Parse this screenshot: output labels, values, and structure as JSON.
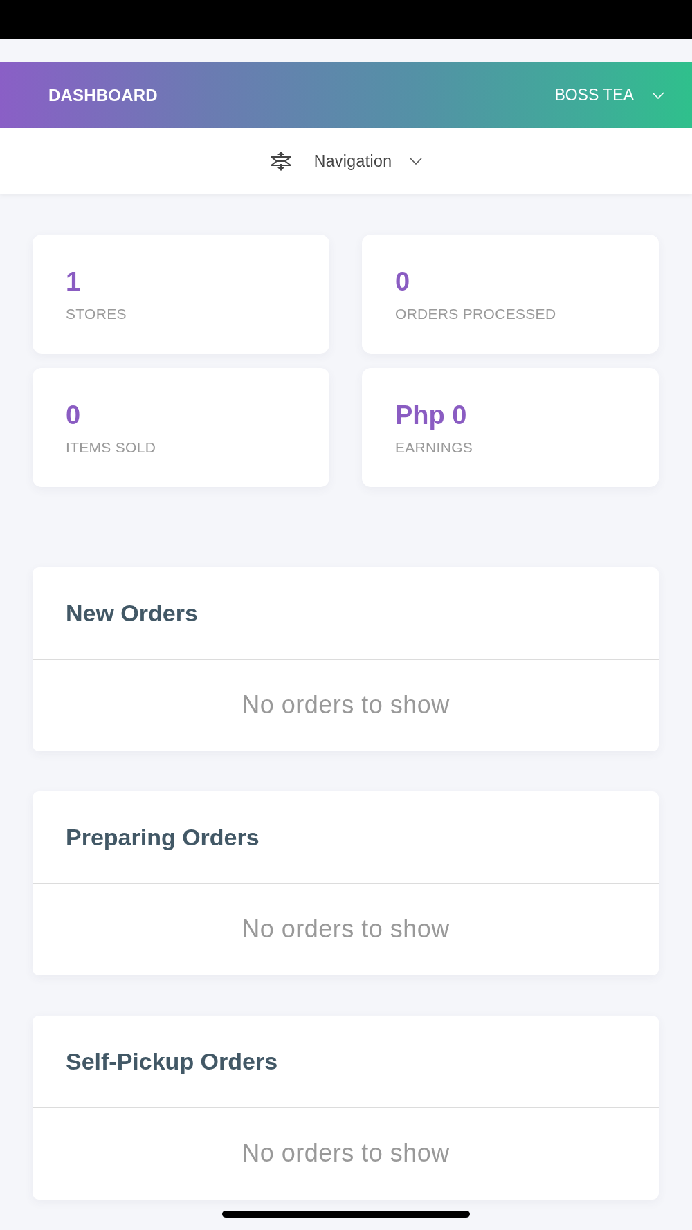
{
  "header": {
    "title": "DASHBOARD",
    "account": "BOSS TEA"
  },
  "navigation": {
    "label": "Navigation"
  },
  "stats": [
    {
      "value": "1",
      "label": "STORES"
    },
    {
      "value": "0",
      "label": "ORDERS PROCESSED"
    },
    {
      "value": "0",
      "label": "ITEMS SOLD"
    },
    {
      "value": "Php 0",
      "label": "EARNINGS"
    }
  ],
  "panels": [
    {
      "title": "New Orders",
      "empty_message": "No orders to show"
    },
    {
      "title": "Preparing Orders",
      "empty_message": "No orders to show"
    },
    {
      "title": "Self-Pickup Orders",
      "empty_message": "No orders to show"
    }
  ]
}
